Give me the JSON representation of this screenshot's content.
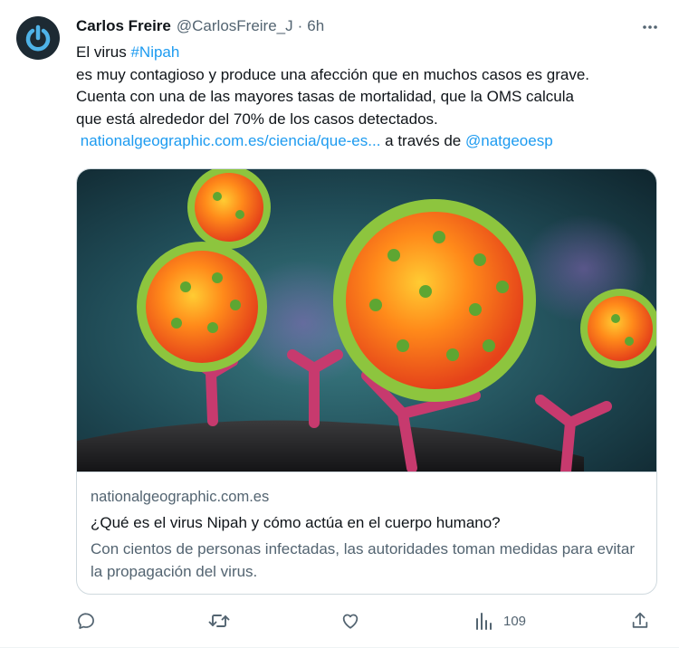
{
  "author": {
    "name": "Carlos Freire",
    "handle": "@CarlosFreire_J",
    "separator": "·",
    "time": "6h"
  },
  "tweet": {
    "line1_prefix": "El virus ",
    "hashtag": "#Nipah",
    "line2": "es muy contagioso y produce una afección que en muchos casos es grave.",
    "line3": "Cuenta con una de las mayores tasas de mortalidad, que la OMS calcula",
    "line4": "que está alrededor del 70% de los casos detectados.",
    "link_text": "nationalgeographic.com.es/ciencia/que-es...",
    "via_text": " a través de ",
    "mention": "@natgeoesp"
  },
  "card": {
    "domain": "nationalgeographic.com.es",
    "title": "¿Qué es el virus Nipah y cómo actúa en el cuerpo humano?",
    "description": "Con cientos de personas infectadas, las autoridades toman medidas para evitar la propagación del virus."
  },
  "actions": {
    "views_count": "109"
  },
  "colors": {
    "accent": "#1d9bf0",
    "secondary_text": "#536471",
    "primary_text": "#0f1419",
    "avatar_bg": "#1d2a33",
    "avatar_ring": "#4fb3e8"
  },
  "icons": {
    "avatar": "power-icon",
    "more": "more-dots-icon",
    "reply": "reply-icon",
    "retweet": "retweet-icon",
    "like": "heart-icon",
    "views": "views-chart-icon",
    "share": "share-icon"
  }
}
